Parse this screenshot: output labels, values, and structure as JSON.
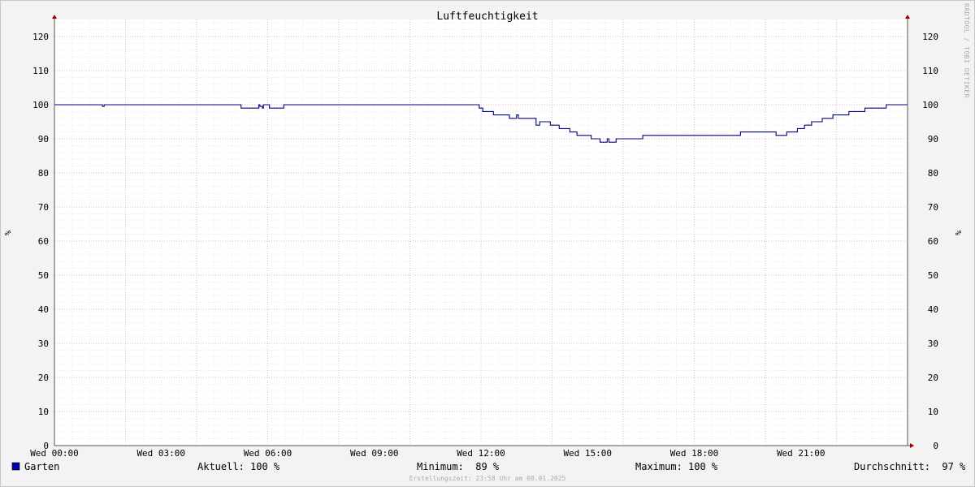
{
  "chart_data": {
    "type": "line",
    "title": "Luftfeuchtigkeit",
    "ylabel": "%",
    "ylim": [
      0,
      125
    ],
    "yticks": [
      0,
      10,
      20,
      30,
      40,
      50,
      60,
      70,
      80,
      90,
      100,
      110,
      120
    ],
    "xlim": [
      0,
      24
    ],
    "xticks": [
      {
        "h": 0,
        "label": "Wed 00:00"
      },
      {
        "h": 3,
        "label": "Wed 03:00"
      },
      {
        "h": 6,
        "label": "Wed 06:00"
      },
      {
        "h": 9,
        "label": "Wed 09:00"
      },
      {
        "h": 12,
        "label": "Wed 12:00"
      },
      {
        "h": 15,
        "label": "Wed 15:00"
      },
      {
        "h": 18,
        "label": "Wed 18:00"
      },
      {
        "h": 21,
        "label": "Wed 21:00"
      }
    ],
    "grid": true,
    "series": [
      {
        "name": "Garten",
        "color": "#000080",
        "legend_color": "#0000aa",
        "step": true,
        "x": [
          0,
          1.35,
          1.4,
          1.45,
          5.25,
          5.75,
          5.78,
          5.85,
          5.88,
          6.0,
          6.05,
          6.1,
          6.45,
          11.95,
          12.05,
          12.35,
          12.8,
          13.0,
          13.05,
          13.15,
          13.2,
          13.55,
          13.65,
          13.95,
          14.2,
          14.5,
          14.7,
          15.1,
          15.35,
          15.5,
          15.55,
          15.6,
          15.8,
          16.55,
          17.1,
          17.4,
          19.3,
          20.3,
          20.6,
          20.9,
          21.1,
          21.3,
          21.6,
          21.9,
          22.35,
          22.8,
          23.2,
          23.4,
          24.0
        ],
        "values": [
          100,
          99.5,
          100,
          100,
          99,
          100,
          99.5,
          99,
          100,
          100,
          99,
          99,
          100,
          99,
          98,
          97,
          96,
          97,
          96,
          96,
          96,
          94,
          95,
          94,
          93,
          92,
          91,
          90,
          89,
          89,
          90,
          89,
          90,
          91,
          91,
          91,
          92,
          91,
          92,
          93,
          94,
          95,
          96,
          97,
          98,
          99,
          99,
          100,
          100
        ]
      }
    ]
  },
  "watermark": "RRDTOOL / TOBI OETIKER",
  "legend": {
    "series_name": "Garten",
    "current": "Aktuell: 100 %",
    "minimum": "Minimum:  89 %",
    "maximum": "Maximum: 100 %",
    "average": "Durchschnitt:  97 %"
  },
  "footer": "Erstellungszeit: 23:58 Uhr am 08.01.2025"
}
